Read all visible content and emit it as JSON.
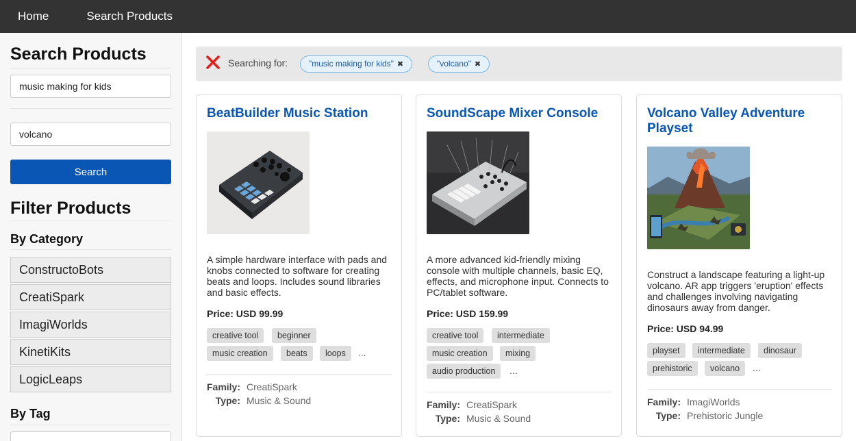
{
  "nav": {
    "home_label": "Home",
    "search_label": "Search Products"
  },
  "sidebar": {
    "search_title": "Search Products",
    "query1": "music making for kids",
    "query2": "volcano",
    "search_button": "Search",
    "filter_title": "Filter Products",
    "by_category": "By Category",
    "categories": [
      "ConstructoBots",
      "CreatiSpark",
      "ImagiWorlds",
      "KinetiKits",
      "LogicLeaps"
    ],
    "by_tag": "By Tag"
  },
  "search_bar": {
    "label": "Searching for:",
    "chips": [
      "\"music making for kids\"",
      "\"volcano\""
    ],
    "remove_glyph": "✖"
  },
  "products": [
    {
      "title": "BeatBuilder Music Station",
      "description": "A simple hardware interface with pads and knobs connected to software for creating beats and loops. Includes sound libraries and basic effects.",
      "price": "Price: USD 99.99",
      "tags": [
        "creative tool",
        "beginner",
        "music creation",
        "beats",
        "loops"
      ],
      "more": "...",
      "family_label": "Family:",
      "family": "CreatiSpark",
      "type_label": "Type:",
      "type": "Music & Sound"
    },
    {
      "title": "SoundScape Mixer Console",
      "description": "A more advanced kid-friendly mixing console with multiple channels, basic EQ, effects, and microphone input. Connects to PC/tablet software.",
      "price": "Price: USD 159.99",
      "tags": [
        "creative tool",
        "intermediate",
        "music creation",
        "mixing",
        "audio production"
      ],
      "more": "...",
      "family_label": "Family:",
      "family": "CreatiSpark",
      "type_label": "Type:",
      "type": "Music & Sound"
    },
    {
      "title": "Volcano Valley Adventure Playset",
      "description": "Construct a landscape featuring a light-up volcano. AR app triggers 'eruption' effects and challenges involving navigating dinosaurs away from danger.",
      "price": "Price: USD 94.99",
      "tags": [
        "playset",
        "intermediate",
        "dinosaur",
        "prehistoric",
        "volcano"
      ],
      "more": "...",
      "family_label": "Family:",
      "family": "ImagiWorlds",
      "type_label": "Type:",
      "type": "Prehistoric Jungle"
    }
  ],
  "colors": {
    "nav_bg": "#333333",
    "accent": "#0a56b5",
    "clear_icon": "#e0201b"
  }
}
